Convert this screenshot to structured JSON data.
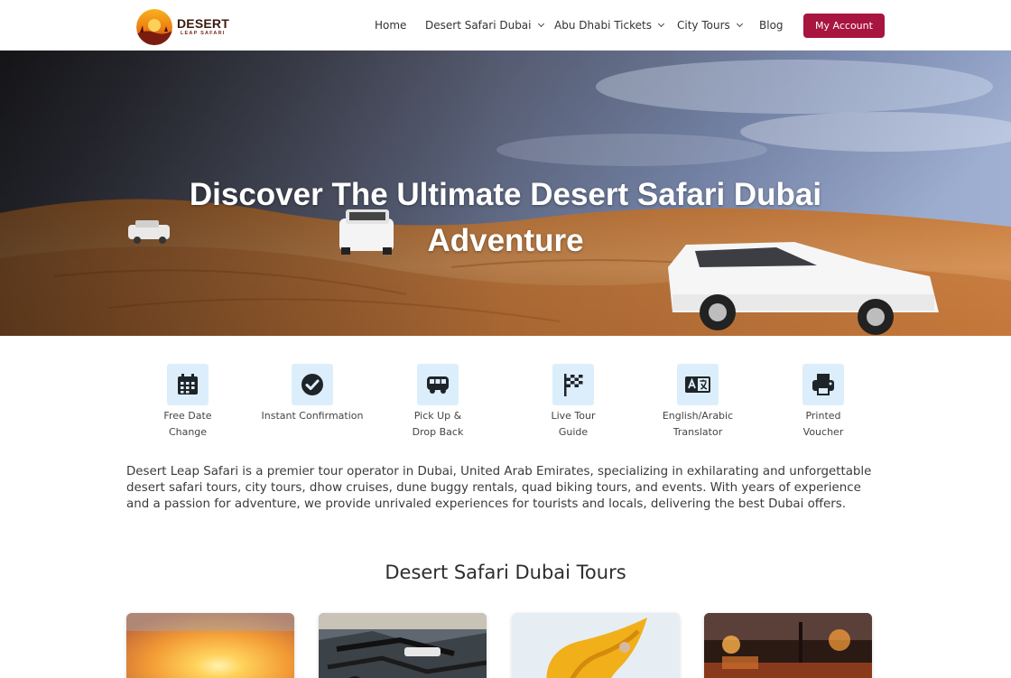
{
  "brand": {
    "logo_title": "DESERT",
    "logo_subtitle": "LEAP SAFARI",
    "accent_color": "#a8153f"
  },
  "nav": {
    "items": [
      {
        "label": "Home",
        "has_dropdown": false
      },
      {
        "label": "Desert Safari Dubai",
        "has_dropdown": true
      },
      {
        "label": "Abu Dhabi Tickets",
        "has_dropdown": true
      },
      {
        "label": "City Tours",
        "has_dropdown": true
      },
      {
        "label": "Blog",
        "has_dropdown": false
      }
    ],
    "account_button": "My Account"
  },
  "hero": {
    "title_line1": "Discover The Ultimate Desert Safari Dubai",
    "title_line2": "Adventure"
  },
  "features": [
    {
      "icon": "calendar-icon",
      "line1": "Free Date",
      "line2": "Change"
    },
    {
      "icon": "check-circle-icon",
      "line1": "Instant Confirmation",
      "line2": ""
    },
    {
      "icon": "van-icon",
      "line1": "Pick Up &",
      "line2": "Drop Back"
    },
    {
      "icon": "flag-checkered-icon",
      "line1": "Live Tour",
      "line2": "Guide"
    },
    {
      "icon": "translate-icon",
      "line1": "English/Arabic",
      "line2": "Translator"
    },
    {
      "icon": "printer-icon",
      "line1": "Printed",
      "line2": "Voucher"
    }
  ],
  "intro": "Desert Leap Safari is a premier tour operator in Dubai, United Arab Emirates, specializing in exhilarating and unforgettable desert safari tours, city tours, dhow cruises, dune buggy rentals, quad biking tours, and events. With years of experience and a passion for adventure, we provide unrivaled experiences for tourists and locals, delivering the best Dubai offers.",
  "tours_section": {
    "title": "Desert Safari Dubai Tours",
    "cards": [
      {
        "image": "sunset-desert-image"
      },
      {
        "image": "dune-buggy-image"
      },
      {
        "image": "dancer-image"
      },
      {
        "image": "desert-camp-image"
      }
    ]
  }
}
